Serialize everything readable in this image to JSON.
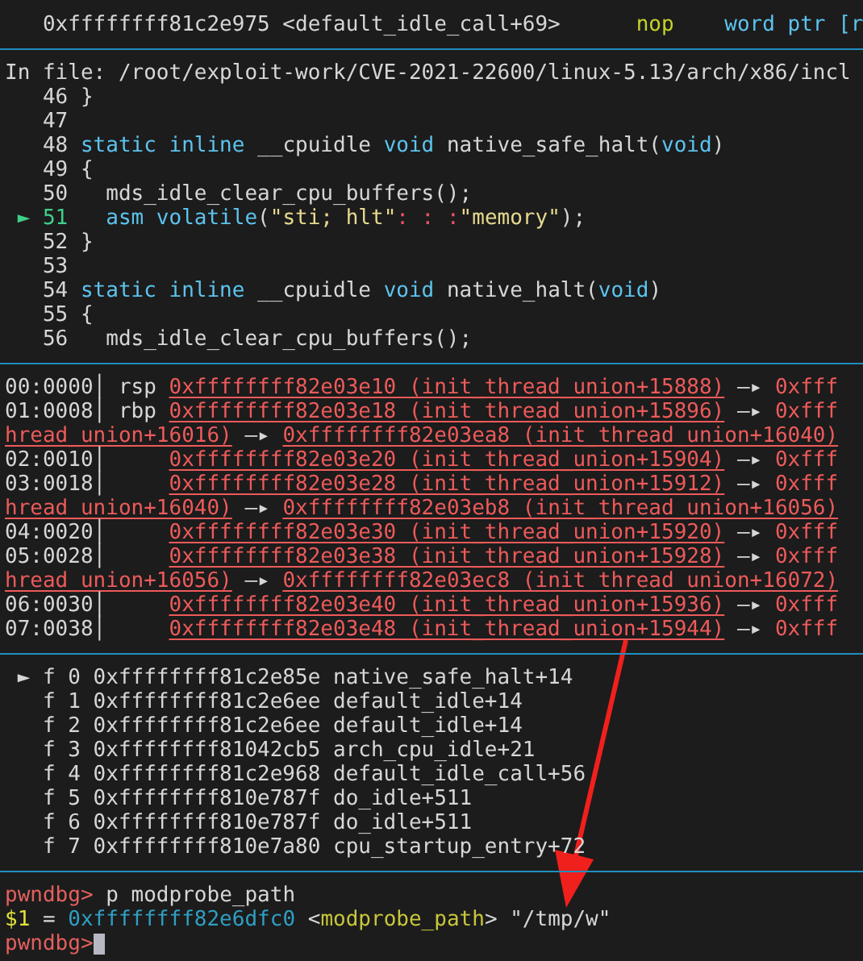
{
  "sections": [
    {
      "lines": [
        {
          "segments": [
            {
              "text": "   0xffffffff81c2e975 <default_idle_call+69>      ",
              "kind": "plain"
            },
            {
              "text": "nop",
              "kind": "mnemonic"
            },
            {
              "text": "    word ptr [r",
              "kind": "keyword"
            }
          ]
        }
      ]
    },
    {
      "header": "In file: /root/exploit-work/CVE-2021-22600/linux-5.13/arch/x86/incl",
      "lines": [
        {
          "segments": [
            {
              "text": "   46 }",
              "kind": "plain"
            }
          ]
        },
        {
          "segments": [
            {
              "text": "   47",
              "kind": "plain"
            }
          ]
        },
        {
          "segments": [
            {
              "text": "   48 ",
              "kind": "plain"
            },
            {
              "text": "static inline",
              "kind": "keyword"
            },
            {
              "text": " __cpuidle ",
              "kind": "plain"
            },
            {
              "text": "void",
              "kind": "keyword"
            },
            {
              "text": " native_safe_halt(",
              "kind": "plain"
            },
            {
              "text": "void",
              "kind": "keyword"
            },
            {
              "text": ")",
              "kind": "plain"
            }
          ]
        },
        {
          "segments": [
            {
              "text": "   49 {",
              "kind": "plain"
            }
          ]
        },
        {
          "segments": [
            {
              "text": "   50   mds_idle_clear_cpu_buffers();",
              "kind": "plain"
            }
          ]
        },
        {
          "segments": [
            {
              "text": " ► 51",
              "kind": "current"
            },
            {
              "text": "   asm volatile",
              "kind": "keyword"
            },
            {
              "text": "(",
              "kind": "plain"
            },
            {
              "text": "\"sti; hlt\"",
              "kind": "string"
            },
            {
              "text": ": : :",
              "kind": "punct"
            },
            {
              "text": "\"memory\"",
              "kind": "string"
            },
            {
              "text": ");",
              "kind": "plain"
            }
          ]
        },
        {
          "segments": [
            {
              "text": "   52 }",
              "kind": "plain"
            }
          ]
        },
        {
          "segments": [
            {
              "text": "   53",
              "kind": "plain"
            }
          ]
        },
        {
          "segments": [
            {
              "text": "   54 ",
              "kind": "plain"
            },
            {
              "text": "static inline",
              "kind": "keyword"
            },
            {
              "text": " __cpuidle ",
              "kind": "plain"
            },
            {
              "text": "void",
              "kind": "keyword"
            },
            {
              "text": " native_halt(",
              "kind": "plain"
            },
            {
              "text": "void",
              "kind": "keyword"
            },
            {
              "text": ")",
              "kind": "plain"
            }
          ]
        },
        {
          "segments": [
            {
              "text": "   55 {",
              "kind": "plain"
            }
          ]
        },
        {
          "segments": [
            {
              "text": "   56   mds_idle_clear_cpu_buffers();",
              "kind": "plain"
            }
          ]
        }
      ]
    },
    {
      "lines": [
        {
          "segments": [
            {
              "text": "00:0000│ rsp ",
              "kind": "plain"
            },
            {
              "text": "0xffffffff82e03e10 (init_thread_union+15888)",
              "kind": "pointer"
            },
            {
              "text": " —▸ ",
              "kind": "plain"
            },
            {
              "text": "0xfff",
              "kind": "red"
            }
          ]
        },
        {
          "segments": [
            {
              "text": "01:0008│ rbp ",
              "kind": "plain"
            },
            {
              "text": "0xffffffff82e03e18 (init_thread_union+15896)",
              "kind": "pointer"
            },
            {
              "text": " —▸ ",
              "kind": "plain"
            },
            {
              "text": "0xfff",
              "kind": "red"
            }
          ]
        },
        {
          "segments": [
            {
              "text": "hread_union+16016)",
              "kind": "pointer"
            },
            {
              "text": " —▸ ",
              "kind": "plain"
            },
            {
              "text": "0xffffffff82e03ea8 (init_thread_union+16040)",
              "kind": "pointer"
            }
          ]
        },
        {
          "segments": [
            {
              "text": "02:0010│     ",
              "kind": "plain"
            },
            {
              "text": "0xffffffff82e03e20 (init_thread_union+15904)",
              "kind": "pointer"
            },
            {
              "text": " —▸ ",
              "kind": "plain"
            },
            {
              "text": "0xfff",
              "kind": "red"
            }
          ]
        },
        {
          "segments": [
            {
              "text": "03:0018│     ",
              "kind": "plain"
            },
            {
              "text": "0xffffffff82e03e28 (init_thread_union+15912)",
              "kind": "pointer"
            },
            {
              "text": " —▸ ",
              "kind": "plain"
            },
            {
              "text": "0xfff",
              "kind": "red"
            }
          ]
        },
        {
          "segments": [
            {
              "text": "hread_union+16040)",
              "kind": "pointer"
            },
            {
              "text": " —▸ ",
              "kind": "plain"
            },
            {
              "text": "0xffffffff82e03eb8 (init_thread_union+16056)",
              "kind": "pointer"
            }
          ]
        },
        {
          "segments": [
            {
              "text": "04:0020│     ",
              "kind": "plain"
            },
            {
              "text": "0xffffffff82e03e30 (init_thread_union+15920)",
              "kind": "pointer"
            },
            {
              "text": " —▸ ",
              "kind": "plain"
            },
            {
              "text": "0xfff",
              "kind": "red"
            }
          ]
        },
        {
          "segments": [
            {
              "text": "05:0028│     ",
              "kind": "plain"
            },
            {
              "text": "0xffffffff82e03e38 (init_thread_union+15928)",
              "kind": "pointer"
            },
            {
              "text": " —▸ ",
              "kind": "plain"
            },
            {
              "text": "0xfff",
              "kind": "red"
            }
          ]
        },
        {
          "segments": [
            {
              "text": "hread_union+16056)",
              "kind": "pointer"
            },
            {
              "text": " —▸ ",
              "kind": "plain"
            },
            {
              "text": "0xffffffff82e03ec8 (init_thread_union+16072)",
              "kind": "pointer"
            }
          ]
        },
        {
          "segments": [
            {
              "text": "06:0030│     ",
              "kind": "plain"
            },
            {
              "text": "0xffffffff82e03e40 (init_thread_union+15936)",
              "kind": "pointer"
            },
            {
              "text": " —▸ ",
              "kind": "plain"
            },
            {
              "text": "0xfff",
              "kind": "red"
            }
          ]
        },
        {
          "segments": [
            {
              "text": "07:0038│     ",
              "kind": "plain"
            },
            {
              "text": "0xffffffff82e03e48 (init_thread_union+15944)",
              "kind": "pointer"
            },
            {
              "text": " —▸ ",
              "kind": "plain"
            },
            {
              "text": "0xfff",
              "kind": "red"
            }
          ]
        }
      ]
    },
    {
      "lines": [
        {
          "segments": [
            {
              "text": " ► f 0 0xffffffff81c2e85e native_safe_halt+14",
              "kind": "plain"
            }
          ]
        },
        {
          "segments": [
            {
              "text": "   f 1 0xffffffff81c2e6ee default_idle+14",
              "kind": "plain"
            }
          ]
        },
        {
          "segments": [
            {
              "text": "   f 2 0xffffffff81c2e6ee default_idle+14",
              "kind": "plain"
            }
          ]
        },
        {
          "segments": [
            {
              "text": "   f 3 0xffffffff81042cb5 arch_cpu_idle+21",
              "kind": "plain"
            }
          ]
        },
        {
          "segments": [
            {
              "text": "   f 4 0xffffffff81c2e968 default_idle_call+56",
              "kind": "plain"
            }
          ]
        },
        {
          "segments": [
            {
              "text": "   f 5 0xffffffff810e787f do_idle+511",
              "kind": "plain"
            }
          ]
        },
        {
          "segments": [
            {
              "text": "   f 6 0xffffffff810e787f do_idle+511",
              "kind": "plain"
            }
          ]
        },
        {
          "segments": [
            {
              "text": "   f 7 0xffffffff810e7a80 cpu_startup_entry+72",
              "kind": "plain"
            }
          ]
        }
      ]
    },
    {
      "lines": [
        {
          "segments": [
            {
              "text": "pwndbg>",
              "kind": "prompt"
            },
            {
              "text": " p modprobe_path",
              "kind": "plain"
            }
          ]
        },
        {
          "segments": [
            {
              "text": "$1",
              "kind": "variable"
            },
            {
              "text": " = ",
              "kind": "plain"
            },
            {
              "text": "0xffffffff82e6dfc0",
              "kind": "address"
            },
            {
              "text": " <",
              "kind": "plain"
            },
            {
              "text": "modprobe_path",
              "kind": "symbol"
            },
            {
              "text": "> \"/tmp/w\"",
              "kind": "plain"
            }
          ]
        },
        {
          "segments": [
            {
              "text": "pwndbg>",
              "kind": "prompt"
            }
          ],
          "cursor": true
        }
      ]
    }
  ],
  "annotation_arrow": true
}
